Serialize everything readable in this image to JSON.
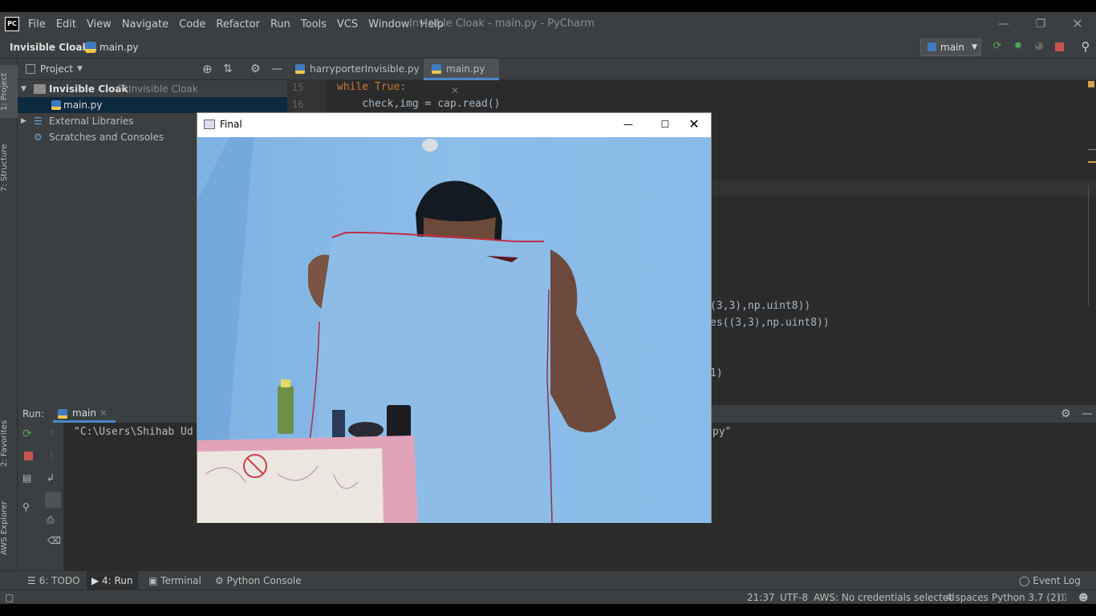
{
  "app": {
    "window_title": "Invisible Cloak - main.py - PyCharm",
    "menu": [
      "File",
      "Edit",
      "View",
      "Navigate",
      "Code",
      "Refactor",
      "Run",
      "Tools",
      "VCS",
      "Window",
      "Help"
    ],
    "breadcrumb": {
      "project": "Invisible Cloak",
      "file": "main.py"
    },
    "run_config": "main"
  },
  "left_tabs": {
    "project": "1: Project",
    "structure": "7: Structure",
    "favorites": "2: Favorites",
    "aws": "AWS Explorer"
  },
  "project_panel": {
    "title": "Project",
    "root_name": "Invisible Cloak",
    "root_path": "F:\\Invisible Cloak",
    "file": "main.py",
    "libs": "External Libraries",
    "scratches": "Scratches and Consoles"
  },
  "editor": {
    "tabs": [
      "harryporterInvisible.py",
      "main.py"
    ],
    "line_numbers": [
      "15",
      "16"
    ],
    "line15": "while True:",
    "line16": "    check,img = cap.read()",
    "frag1": "(3,3),np.uint8))",
    "frag2": "es((3,3),np.uint8))",
    "frag3": "1)"
  },
  "run_panel": {
    "label": "Run:",
    "tab": "main",
    "output_left": "\"C:\\Users\\Shihab Ud",
    "output_right": "py\""
  },
  "bottom_tabs": [
    "6: TODO",
    "4: Run",
    "Terminal",
    "Python Console"
  ],
  "event_log": "Event Log",
  "status": {
    "position": "21:37",
    "encoding": "UTF-8",
    "aws": "AWS: No credentials selected",
    "indent": "4 spaces",
    "interpreter": "Python 3.7 (2)"
  },
  "final_window": {
    "title": "Final"
  },
  "colors": {
    "keyword": "#cc7832",
    "code": "#a9b7c6",
    "number": "#6897bb",
    "bg": "#2b2b2b",
    "panel": "#3c3f41",
    "selection": "#0d293e"
  }
}
